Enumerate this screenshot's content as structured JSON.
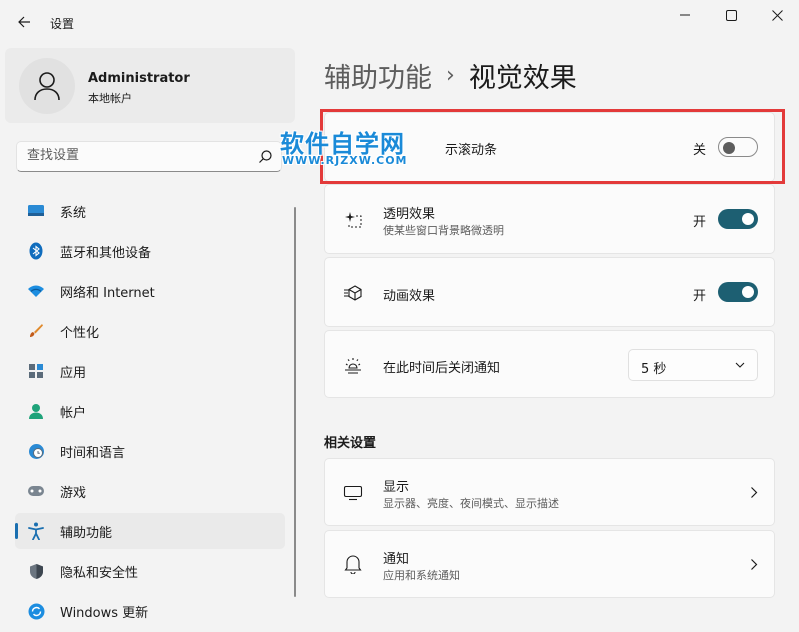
{
  "window": {
    "title": "设置"
  },
  "profile": {
    "name": "Administrator",
    "account_type": "本地帐户"
  },
  "search": {
    "placeholder": "查找设置"
  },
  "sidebar": {
    "items": [
      {
        "label": "系统",
        "icon": "monitor-icon",
        "active": false
      },
      {
        "label": "蓝牙和其他设备",
        "icon": "bluetooth-icon",
        "active": false
      },
      {
        "label": "网络和 Internet",
        "icon": "wifi-icon",
        "active": false
      },
      {
        "label": "个性化",
        "icon": "brush-icon",
        "active": false
      },
      {
        "label": "应用",
        "icon": "apps-icon",
        "active": false
      },
      {
        "label": "帐户",
        "icon": "person-icon",
        "active": false
      },
      {
        "label": "时间和语言",
        "icon": "globe-clock-icon",
        "active": false
      },
      {
        "label": "游戏",
        "icon": "gamepad-icon",
        "active": false
      },
      {
        "label": "辅助功能",
        "icon": "accessibility-icon",
        "active": true
      },
      {
        "label": "隐私和安全性",
        "icon": "shield-icon",
        "active": false
      },
      {
        "label": "Windows 更新",
        "icon": "update-icon",
        "active": false
      }
    ]
  },
  "breadcrumb": {
    "parent": "辅助功能",
    "separator": "›",
    "current": "视觉效果"
  },
  "settings": {
    "scrollbars": {
      "title_visible": "示滚动条",
      "state": "关",
      "on": false
    },
    "transparency": {
      "title": "透明效果",
      "desc": "使某些窗口背景略微透明",
      "state": "开",
      "on": true
    },
    "animation": {
      "title": "动画效果",
      "state": "开",
      "on": true
    },
    "notification": {
      "title": "在此时间后关闭通知",
      "value": "5 秒"
    }
  },
  "related": {
    "heading": "相关设置",
    "items": [
      {
        "title": "显示",
        "desc": "显示器、亮度、夜间模式、显示描述",
        "icon": "display-icon"
      },
      {
        "title": "通知",
        "desc": "应用和系统通知",
        "icon": "bell-icon"
      }
    ]
  },
  "watermark": {
    "main": "软件自学网",
    "sub": "WWW.RJZXW.COM"
  },
  "colors": {
    "accent": "#1d5f72",
    "highlight_box": "#e33a3a",
    "watermark": "#1a8ad8",
    "nav_indicator": "#1a6fb0"
  }
}
